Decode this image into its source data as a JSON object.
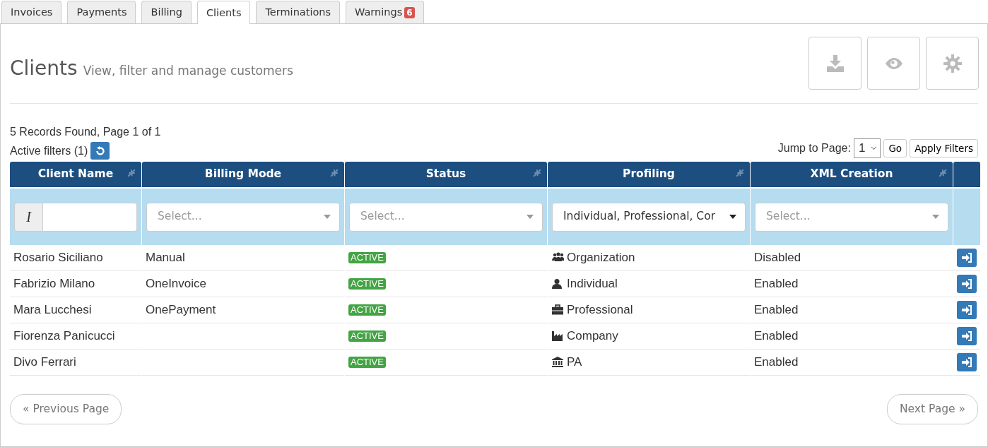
{
  "tabs": [
    {
      "label": "Invoices",
      "selected": false
    },
    {
      "label": "Payments",
      "selected": false
    },
    {
      "label": "Billing",
      "selected": false
    },
    {
      "label": "Clients",
      "selected": true
    },
    {
      "label": "Terminations",
      "selected": false
    },
    {
      "label": "Warnings",
      "selected": false,
      "badge": "6"
    }
  ],
  "header": {
    "title": "Clients",
    "subtitle": "View, filter and manage customers"
  },
  "summary": {
    "records": "5 Records Found, Page 1 of 1",
    "active_filters": "Active filters (1)"
  },
  "pager_form": {
    "label": "Jump to Page:",
    "page": "1",
    "go": "Go",
    "apply": "Apply Filters"
  },
  "table": {
    "columns": [
      "Client Name",
      "Billing Mode",
      "Status",
      "Profiling",
      "XML Creation"
    ],
    "filters": [
      {
        "kind": "text",
        "addon": "I"
      },
      {
        "kind": "select",
        "placeholder": "Select..."
      },
      {
        "kind": "select",
        "placeholder": "Select..."
      },
      {
        "kind": "select",
        "value": "Individual, Professional, Cor"
      },
      {
        "kind": "select",
        "placeholder": "Select..."
      }
    ],
    "rows": [
      {
        "name": "Rosario Siciliano",
        "billing_mode": "Manual",
        "status": "ACTIVE",
        "color": "#43a443",
        "kind": "organization",
        "profile": "Organization",
        "xml": "Disabled"
      },
      {
        "name": "Fabrizio Milano",
        "billing_mode": "OneInvoice",
        "status": "ACTIVE",
        "color": "#43a443",
        "kind": "individual",
        "profile": "Individual",
        "xml": "Enabled"
      },
      {
        "name": "Mara Lucchesi",
        "billing_mode": "OnePayment",
        "status": "ACTIVE",
        "color": "#43a443",
        "kind": "professional",
        "profile": "Professional",
        "xml": "Enabled"
      },
      {
        "name": "Fiorenza Panicucci",
        "status": "ACTIVE",
        "color": "#43a443",
        "kind": "company",
        "profile": "Company",
        "xml": "Enabled"
      },
      {
        "name": "Divo Ferrari",
        "status": "ACTIVE",
        "color": "#43a443",
        "kind": "pa",
        "profile": "PA",
        "xml": "Enabled"
      }
    ]
  },
  "pagination": {
    "previous": "« Previous Page",
    "next": "Next Page »"
  }
}
